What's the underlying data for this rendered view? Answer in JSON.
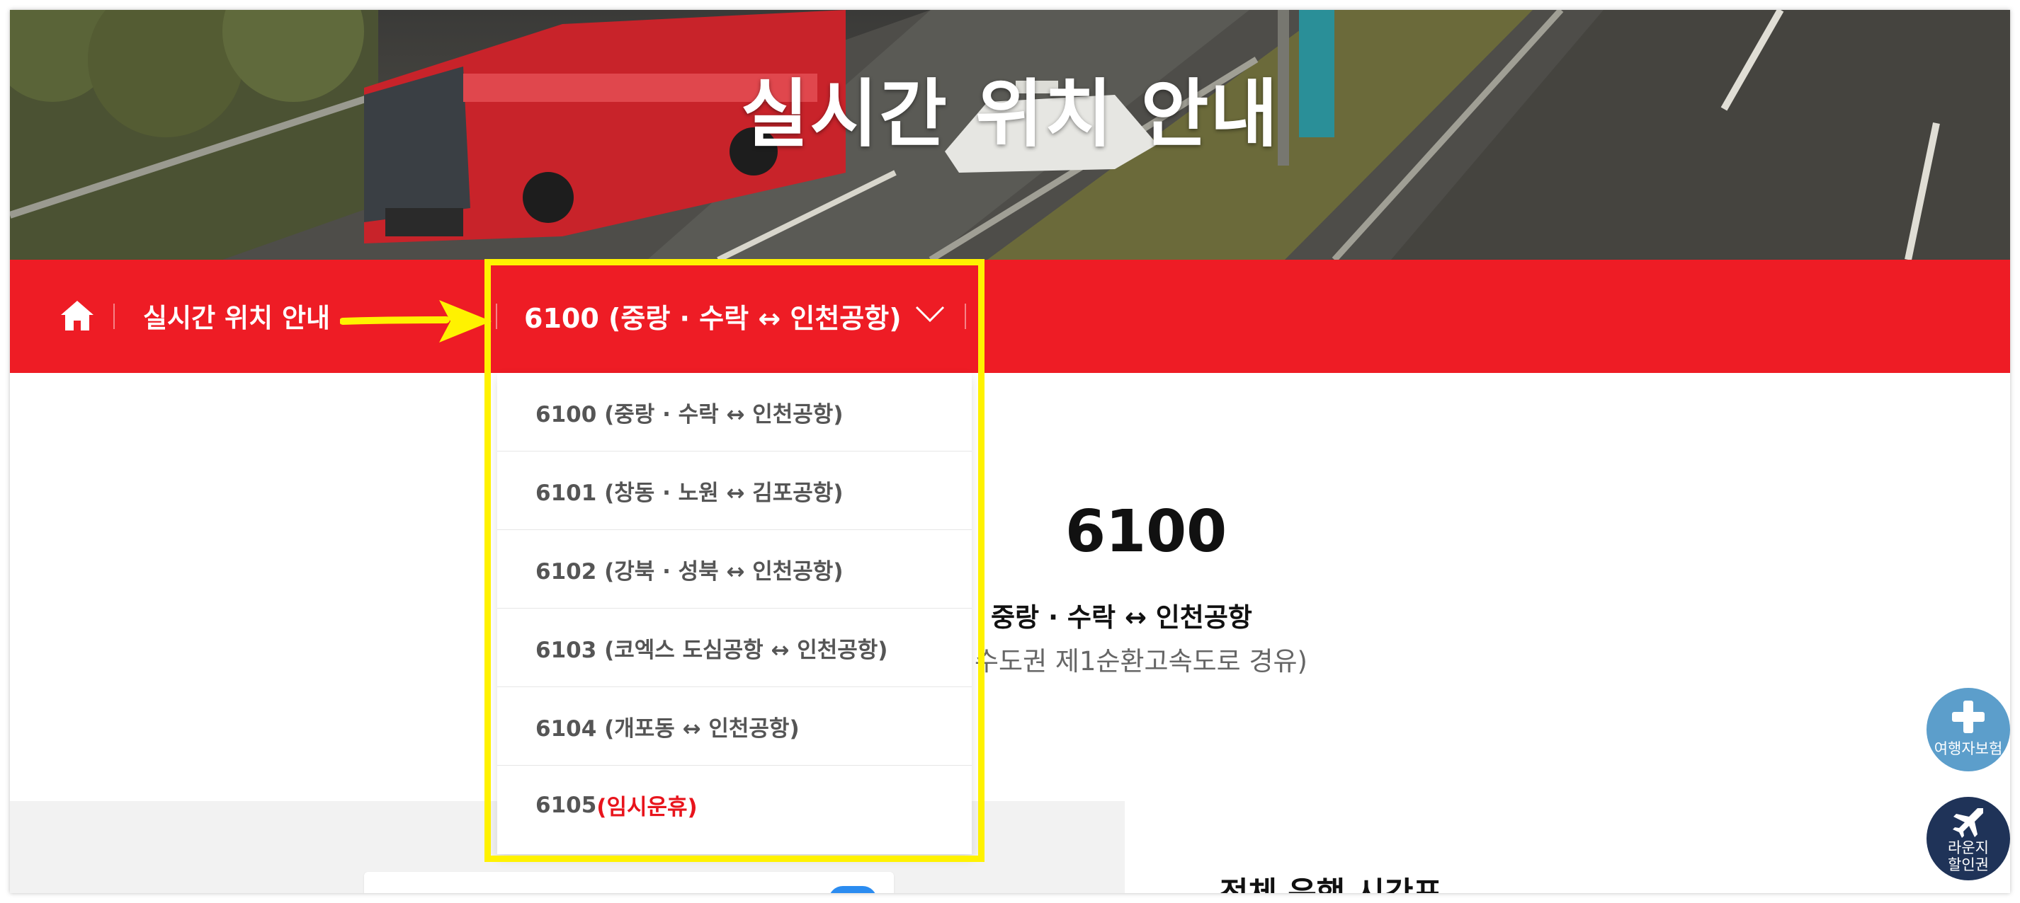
{
  "hero": {
    "title": "실시간 위치 안내"
  },
  "breadcrumb": {
    "home_icon": "home-icon",
    "current_section": "실시간 위치 안내"
  },
  "route_selector": {
    "selected": "6100 (중랑 · 수락 ↔ 인천공항)",
    "icon": "chevron-down-icon",
    "options": [
      {
        "label": "6100 (중랑 · 수락 ↔ 인천공항)"
      },
      {
        "label": "6101 (창동 · 노원 ↔ 김포공항)"
      },
      {
        "label": "6102 (강북 · 성북 ↔ 인천공항)"
      },
      {
        "label": "6103 (코엑스 도심공항 ↔ 인천공항)"
      },
      {
        "label": "6104 (개포동 ↔ 인천공항)"
      },
      {
        "label": "6105",
        "status": "(임시운휴)"
      }
    ]
  },
  "route_info": {
    "number": "6100",
    "name": "중랑 · 수락 ↔ 인천공항",
    "note": "수도권 제1순환고속도로 경유)"
  },
  "timetable": {
    "title": "전체 운행 시간표"
  },
  "floating": {
    "insurance_label": "여행자보험",
    "lounge_label_1": "라운지",
    "lounge_label_2": "할인권"
  },
  "colors": {
    "nav_red": "#ee1c25",
    "highlight_yellow": "#fff200",
    "status_red": "#e8141c",
    "insurance_blue": "#5c9ecb",
    "lounge_navy": "#1f3358"
  }
}
